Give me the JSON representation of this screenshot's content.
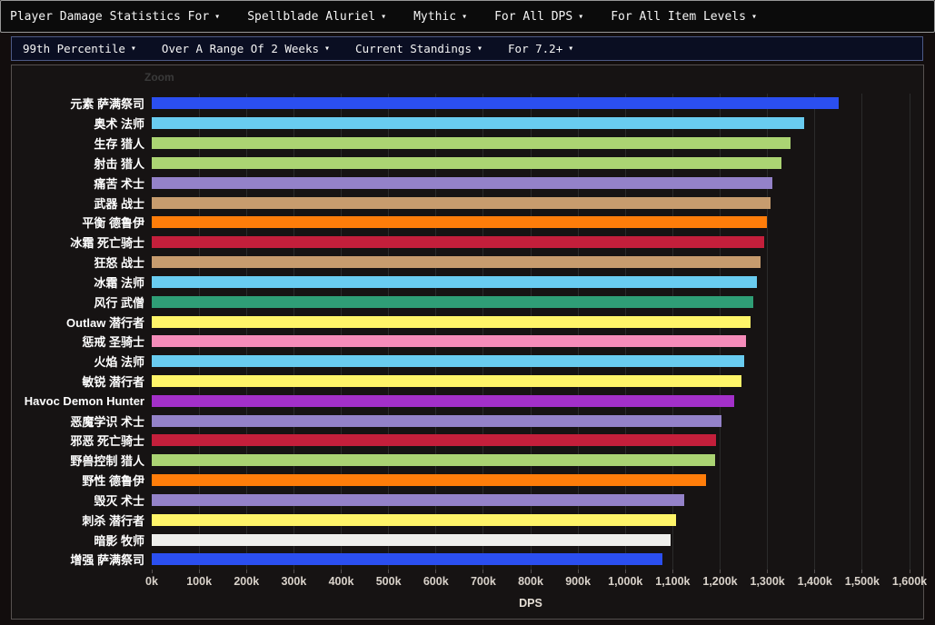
{
  "icons": {
    "caret_glyph": "▾"
  },
  "top_nav": {
    "items": [
      {
        "label": "Player Damage Statistics For"
      },
      {
        "label": "Spellblade Aluriel"
      },
      {
        "label": "Mythic"
      },
      {
        "label": "For All DPS"
      },
      {
        "label": "For All Item Levels"
      }
    ]
  },
  "sub_nav": {
    "items": [
      {
        "label": "99th Percentile"
      },
      {
        "label": "Over A Range Of 2 Weeks"
      },
      {
        "label": "Current Standings"
      },
      {
        "label": "For 7.2+"
      }
    ]
  },
  "chart": {
    "zoom_label": "Zoom"
  },
  "chart_data": {
    "type": "bar",
    "orientation": "horizontal",
    "title": "",
    "xlabel": "DPS",
    "value_unit": "thousand DPS (k)",
    "xlim_k": [
      0,
      1600
    ],
    "x_tick_step_k": 100,
    "x_tick_labels": [
      "0k",
      "100k",
      "200k",
      "300k",
      "400k",
      "500k",
      "600k",
      "700k",
      "800k",
      "900k",
      "1,000k",
      "1,100k",
      "1,200k",
      "1,300k",
      "1,400k",
      "1,500k",
      "1,600k"
    ],
    "grid": true,
    "legend": false,
    "categories": [
      "元素 萨满祭司",
      "奥术 法师",
      "生存 猎人",
      "射击 猎人",
      "痛苦 术士",
      "武器 战士",
      "平衡 德鲁伊",
      "冰霜 死亡骑士",
      "狂怒 战士",
      "冰霜 法师",
      "风行 武僧",
      "Outlaw 潜行者",
      "惩戒 圣骑士",
      "火焰 法师",
      "敏锐 潜行者",
      "Havoc Demon Hunter",
      "恶魔学识 术士",
      "邪恶 死亡骑士",
      "野兽控制 猎人",
      "野性 德鲁伊",
      "毁灭 术士",
      "刺杀 潜行者",
      "暗影 牧师",
      "增强 萨满祭司"
    ],
    "classes": [
      "Shaman",
      "Mage",
      "Hunter",
      "Hunter",
      "Warlock",
      "Warrior",
      "Druid",
      "Death Knight",
      "Warrior",
      "Mage",
      "Monk",
      "Rogue",
      "Paladin",
      "Mage",
      "Rogue",
      "Demon Hunter",
      "Warlock",
      "Death Knight",
      "Hunter",
      "Druid",
      "Warlock",
      "Rogue",
      "Priest",
      "Shaman"
    ],
    "values_k": [
      1450,
      1377,
      1348,
      1329,
      1311,
      1306,
      1298,
      1293,
      1285,
      1278,
      1270,
      1265,
      1254,
      1250,
      1246,
      1229,
      1202,
      1191,
      1189,
      1171,
      1124,
      1107,
      1096,
      1078
    ],
    "colors": [
      "#2b4ff0",
      "#69ccf0",
      "#abd473",
      "#abd473",
      "#9482c9",
      "#c79c6e",
      "#ff7d0a",
      "#c41f3b",
      "#c79c6e",
      "#69ccf0",
      "#2f9e76",
      "#fff569",
      "#f58cba",
      "#69ccf0",
      "#fff569",
      "#a330c9",
      "#9482c9",
      "#c41f3b",
      "#abd473",
      "#ff7d0a",
      "#9482c9",
      "#fff569",
      "#efefec",
      "#2b4ff0"
    ]
  }
}
